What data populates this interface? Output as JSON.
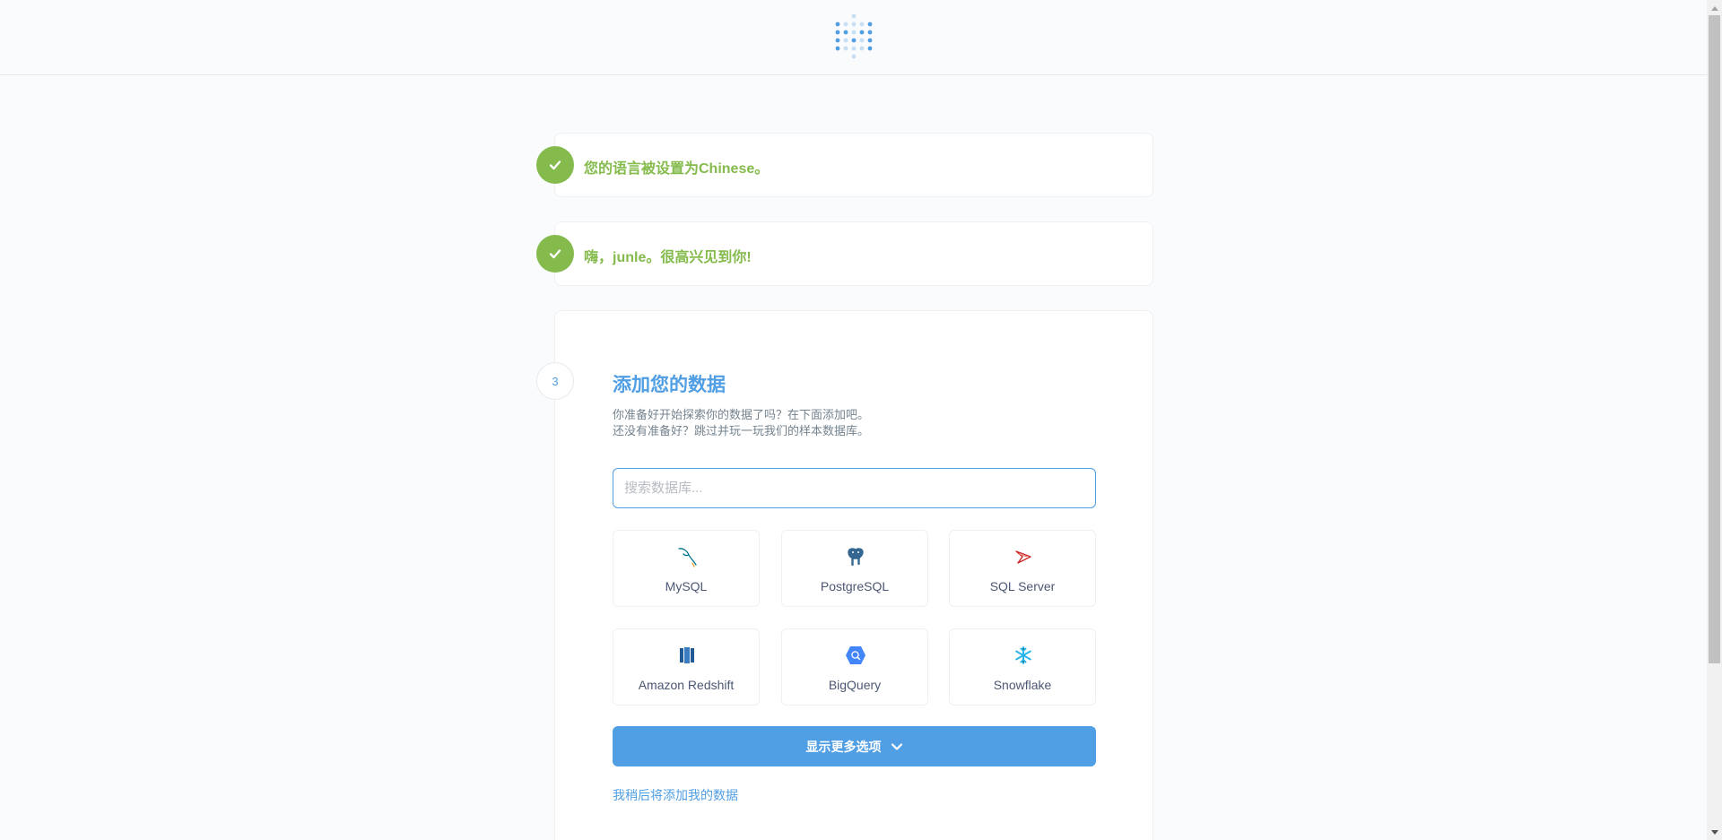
{
  "header": {
    "logo_icon": "metabase-dots-logo"
  },
  "steps": {
    "language": {
      "text": "您的语言被设置为Chinese。",
      "icon": "check-icon"
    },
    "user": {
      "text": "嗨，junle。很高兴见到你!",
      "icon": "check-icon"
    },
    "add_data": {
      "number": "3",
      "title": "添加您的数据",
      "desc_line1": "你准备好开始探索你的数据了吗？在下面添加吧。",
      "desc_line2": "还没有准备好？跳过并玩一玩我们的样本数据库。",
      "search_placeholder": "搜索数据库...",
      "databases": [
        {
          "label": "MySQL",
          "icon": "mysql-dolphin-icon"
        },
        {
          "label": "PostgreSQL",
          "icon": "postgresql-elephant-icon"
        },
        {
          "label": "SQL Server",
          "icon": "sql-server-icon"
        },
        {
          "label": "Amazon Redshift",
          "icon": "redshift-icon"
        },
        {
          "label": "BigQuery",
          "icon": "bigquery-icon"
        },
        {
          "label": "Snowflake",
          "icon": "snowflake-icon"
        }
      ],
      "more_button": "显示更多选项",
      "later_link": "我稍后将添加我的数据"
    }
  },
  "colors": {
    "accent": "#509ee3",
    "success": "#84bb4c",
    "text": "#4c5773",
    "muted": "#74838f"
  }
}
